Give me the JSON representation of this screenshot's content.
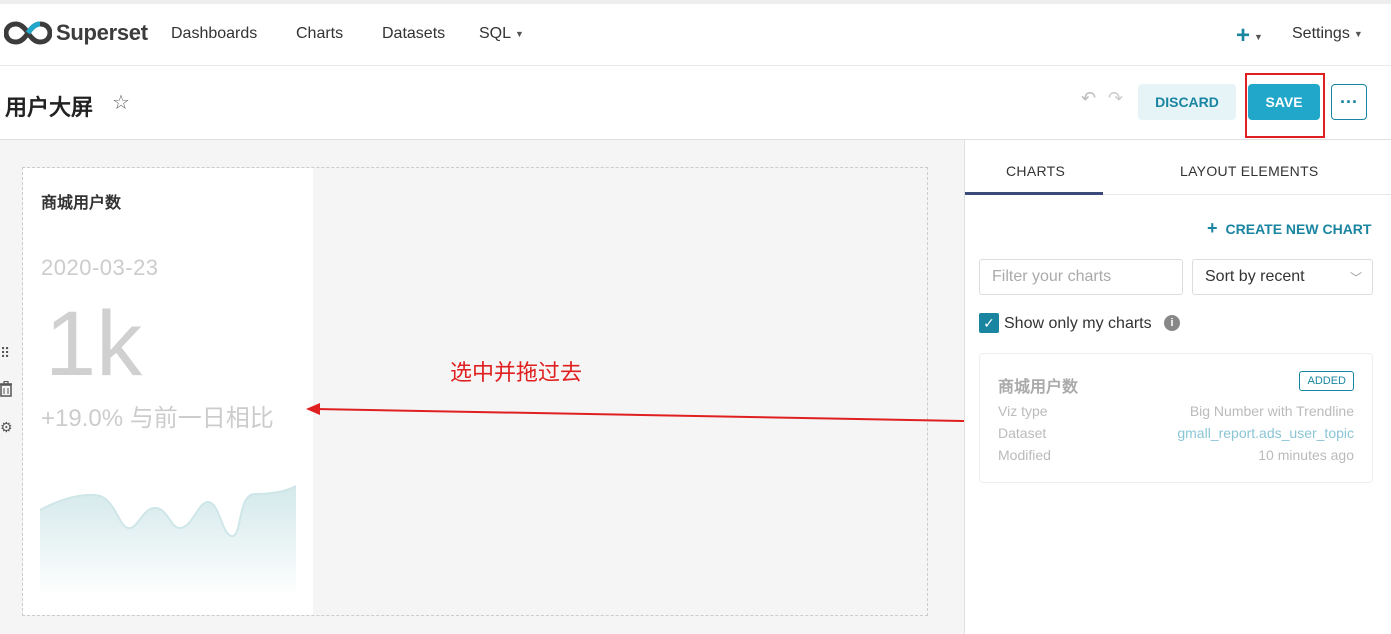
{
  "nav": {
    "brand": "Superset",
    "items": [
      "Dashboards",
      "Charts",
      "Datasets",
      "SQL"
    ],
    "plus": "+",
    "settings": "Settings"
  },
  "header": {
    "title": "用户大屏",
    "discard_label": "DISCARD",
    "save_label": "SAVE",
    "more_label": "···"
  },
  "chart_card": {
    "title": "商城用户数",
    "date": "2020-03-23",
    "big_number": "1k",
    "subheader": "+19.0% 与前一日相比",
    "trend_color": "#cfe6e8"
  },
  "annotation": {
    "text": "选中并拖过去",
    "color": "#e02020"
  },
  "panel": {
    "tabs": [
      "CHARTS",
      "LAYOUT ELEMENTS"
    ],
    "create_new_chart": "CREATE NEW CHART",
    "filter_placeholder": "Filter your charts",
    "sort_value": "Sort by recent",
    "show_only_mine": "Show only my charts",
    "chart_item": {
      "title": "商城用户数",
      "badge": "ADDED",
      "rows": [
        {
          "label": "Viz type",
          "value": "Big Number with Trendline"
        },
        {
          "label": "Dataset",
          "value": "gmall_report.ads_user_topic"
        },
        {
          "label": "Modified",
          "value": "10 minutes ago"
        }
      ]
    }
  },
  "colors": {
    "accent": "#20a7c9",
    "accent_dark": "#1a85a0",
    "highlight": "#e02020"
  }
}
